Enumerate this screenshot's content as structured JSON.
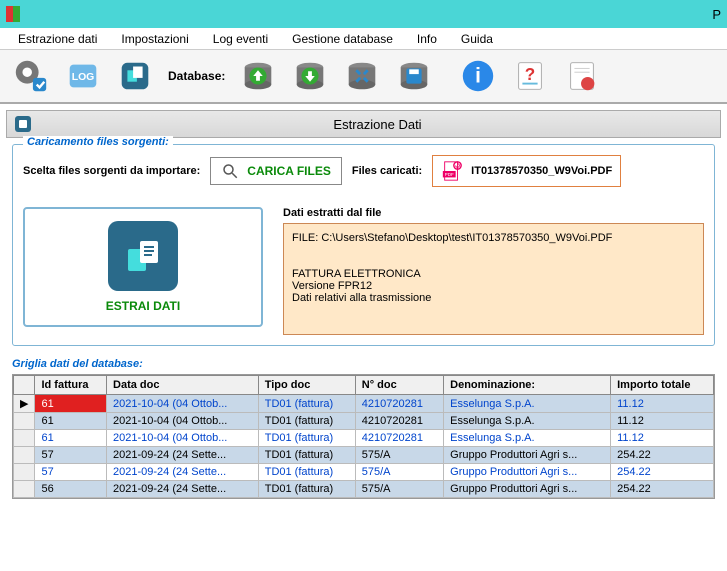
{
  "titlebar": {
    "text": "P"
  },
  "menu": [
    "Estrazione dati",
    "Impostazioni",
    "Log eventi",
    "Gestione database",
    "Info",
    "Guida"
  ],
  "toolbar": {
    "db_label": "Database:"
  },
  "panel": {
    "title": "Estrazione Dati"
  },
  "caricamento": {
    "legend": "Caricamento files sorgenti:",
    "scelta_label": "Scelta files sorgenti da importare:",
    "carica_btn": "CARICA FILES",
    "files_caricati_label": "Files caricati:",
    "file_name": "IT01378570350_W9Voi.PDF"
  },
  "extract": {
    "label": "ESTRAI DATI"
  },
  "dati": {
    "title": "Dati estratti dal file",
    "body": "FILE: C:\\Users\\Stefano\\Desktop\\test\\IT01378570350_W9Voi.PDF\n\n\nFATTURA ELETTRONICA\nVersione FPR12\nDati relativi alla trasmissione"
  },
  "grid": {
    "legend": "Griglia dati del database:",
    "headers": [
      "Id fattura",
      "Data doc",
      "Tipo doc",
      "N° doc",
      "Denominazione:",
      "Importo totale"
    ],
    "rows": [
      {
        "sel": true,
        "marker": "▶",
        "id": "61",
        "data": "2021-10-04 (04 Ottob...",
        "tipo": "TD01 (fattura)",
        "num": "4210720281",
        "denom": "Esselunga S.p.A.",
        "imp": "11.12",
        "link": true
      },
      {
        "sel": true,
        "marker": "",
        "id": "61",
        "data": "2021-10-04 (04 Ottob...",
        "tipo": "TD01 (fattura)",
        "num": "4210720281",
        "denom": "Esselunga S.p.A.",
        "imp": "11.12",
        "link": false
      },
      {
        "sel": false,
        "marker": "",
        "id": "61",
        "data": "2021-10-04 (04 Ottob...",
        "tipo": "TD01 (fattura)",
        "num": "4210720281",
        "denom": "Esselunga S.p.A.",
        "imp": "11.12",
        "link": true
      },
      {
        "sel": true,
        "marker": "",
        "id": "57",
        "data": "2021-09-24 (24 Sette...",
        "tipo": "TD01 (fattura)",
        "num": "575/A",
        "denom": "Gruppo Produttori Agri s...",
        "imp": "254.22",
        "link": false
      },
      {
        "sel": false,
        "marker": "",
        "id": "57",
        "data": "2021-09-24 (24 Sette...",
        "tipo": "TD01 (fattura)",
        "num": "575/A",
        "denom": "Gruppo Produttori Agri s...",
        "imp": "254.22",
        "link": true
      },
      {
        "sel": true,
        "marker": "",
        "id": "56",
        "data": "2021-09-24 (24 Sette...",
        "tipo": "TD01 (fattura)",
        "num": "575/A",
        "denom": "Gruppo Produttori Agri s...",
        "imp": "254.22",
        "link": false
      }
    ]
  }
}
